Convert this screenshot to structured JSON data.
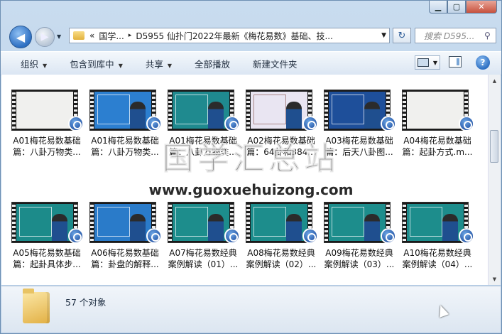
{
  "window": {
    "controls": {
      "minimize": "▁",
      "maximize": "▢",
      "close": "✕"
    }
  },
  "nav": {
    "back_glyph": "◀",
    "forward_glyph": "▶",
    "history_glyph": "▼",
    "breadcrumb": {
      "overflow": "«",
      "parent": "国学...",
      "separator": "▸",
      "current": "D5955 仙扑门2022年最新《梅花易数》基础、技..."
    },
    "address_dropdown": "▼",
    "refresh_glyph": "↻",
    "search_placeholder": "搜索 D595...",
    "search_icon": "⚲"
  },
  "commands": {
    "organize": "组织",
    "include_library": "包含到库中",
    "share": "共享",
    "play_all": "全部播放",
    "new_folder": "新建文件夹",
    "dropdown_glyph": "▼",
    "help_glyph": "?"
  },
  "files": [
    {
      "line1": "A01梅花易数基础",
      "line2": "篇：八卦万物类...",
      "bg": "#f0f0ee",
      "style": "white"
    },
    {
      "line1": "A01梅花易数基础",
      "line2": "篇：八卦万物类...",
      "bg": "#2c7fd0",
      "style": "blue"
    },
    {
      "line1": "A01梅花易数基础",
      "line2": "篇：八卦万物类...",
      "bg": "#1f8a8f",
      "style": "teal"
    },
    {
      "line1": "A02梅花易数基础",
      "line2": "篇：64卦和384...",
      "bg": "#e9e5f2",
      "style": "light"
    },
    {
      "line1": "A03梅花易数基础",
      "line2": "篇：后天八卦图...",
      "bg": "#1e4f9a",
      "style": "blue"
    },
    {
      "line1": "A04梅花易数基础",
      "line2": "篇：起卦方式.m...",
      "bg": "#f0f0ee",
      "style": "white"
    },
    {
      "line1": "A05梅花易数基础",
      "line2": "篇：起卦具体步...",
      "bg": "#1c8b8a",
      "style": "teal"
    },
    {
      "line1": "A06梅花易数基础",
      "line2": "篇：卦盘的解释...",
      "bg": "#2a7bc9",
      "style": "blue"
    },
    {
      "line1": "A07梅花易数经典",
      "line2": "案例解读（01）...",
      "bg": "#1d8d8c",
      "style": "teal"
    },
    {
      "line1": "A08梅花易数经典",
      "line2": "案例解读（02）...",
      "bg": "#1d8d8c",
      "style": "teal"
    },
    {
      "line1": "A09梅花易数经典",
      "line2": "案例解读（03）...",
      "bg": "#1d8d8c",
      "style": "teal"
    },
    {
      "line1": "A10梅花易数经典",
      "line2": "案例解读（04）...",
      "bg": "#1d8d8c",
      "style": "teal"
    }
  ],
  "watermark": {
    "title": "国学汇总站",
    "url": "www.guoxuehuizong.com"
  },
  "status": {
    "count": "57 个对象"
  },
  "scroll": {
    "up": "▲",
    "down": "▼"
  }
}
